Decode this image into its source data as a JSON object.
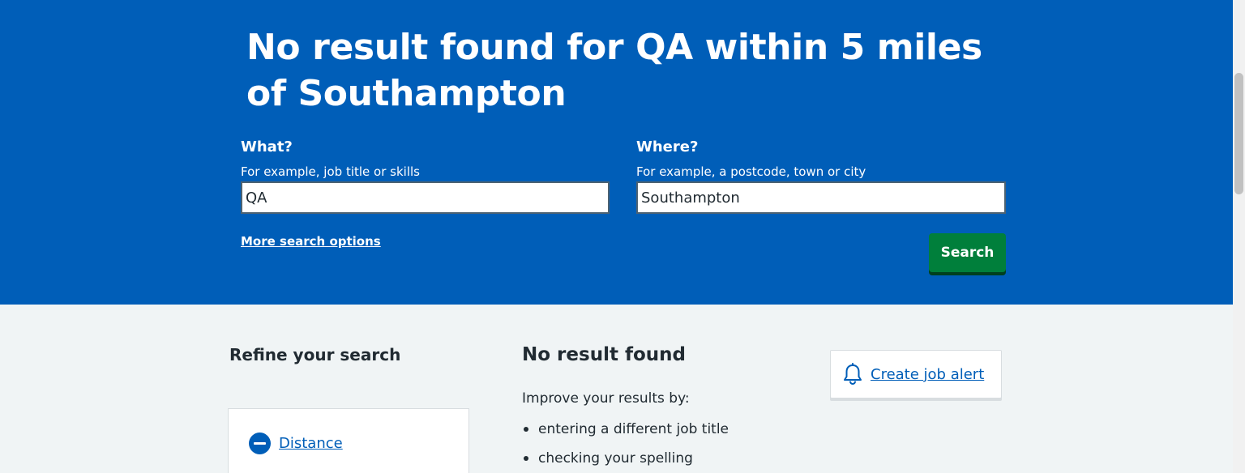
{
  "hero": {
    "title": "No result found for QA within 5 miles of Southampton"
  },
  "search": {
    "what_label": "What?",
    "what_hint": "For example, job title or skills",
    "what_value": "QA",
    "where_label": "Where?",
    "where_hint": "For example, a postcode, town or city",
    "where_value": "Southampton",
    "more_options_label": "More search options",
    "search_button_label": "Search"
  },
  "refine": {
    "title": "Refine your search",
    "distance_label": "Distance"
  },
  "results": {
    "title": "No result found",
    "improve_text": "Improve your results by:",
    "tips": [
      "entering a different job title",
      "checking your spelling"
    ]
  },
  "job_alert": {
    "label": "Create job alert",
    "icon": "bell-icon"
  },
  "colors": {
    "brand_blue": "#005eb8",
    "button_green": "#007f3b",
    "page_background": "#f0f4f5"
  }
}
